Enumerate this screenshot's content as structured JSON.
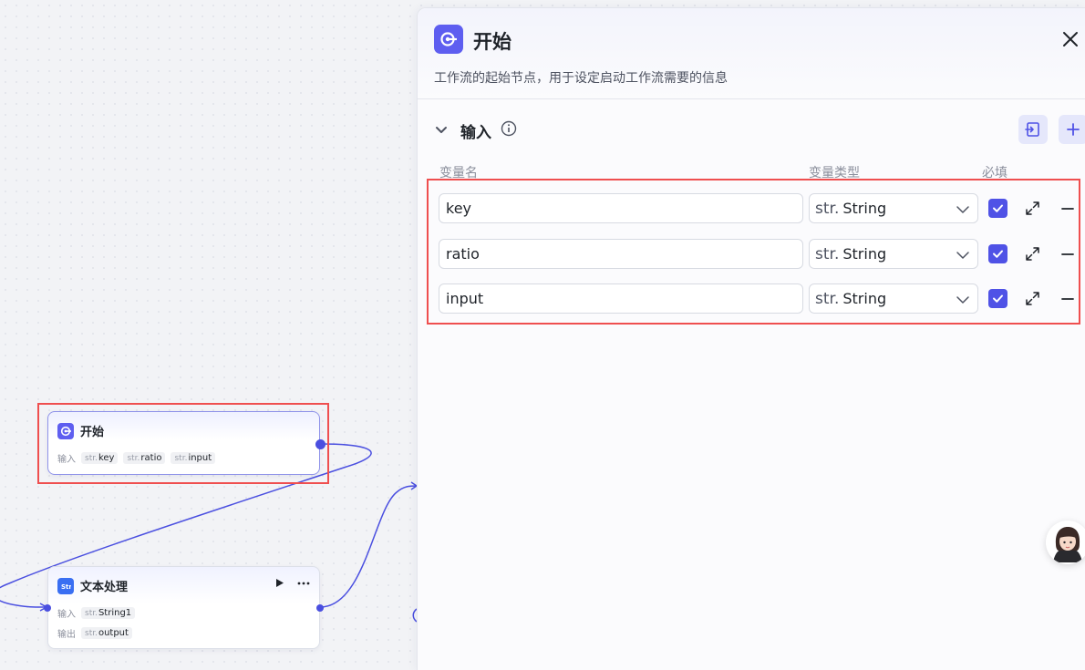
{
  "canvas": {
    "start_node": {
      "title": "开始",
      "input_label": "输入",
      "params": [
        {
          "type": "str.",
          "name": "key"
        },
        {
          "type": "str.",
          "name": "ratio"
        },
        {
          "type": "str.",
          "name": "input"
        }
      ]
    },
    "text_node": {
      "title": "文本处理",
      "run_icon": "play-icon",
      "more_icon": "more-icon",
      "input_label": "输入",
      "output_label": "输出",
      "input_param": {
        "type": "str.",
        "name": "String1"
      },
      "output_param": {
        "type": "str.",
        "name": "output"
      }
    },
    "accent_color": "#4a4fe0",
    "highlight_color": "#ef4f4f"
  },
  "panel": {
    "title": "开始",
    "description": "工作流的起始节点，用于设定启动工作流需要的信息",
    "close_icon": "close-icon",
    "section": {
      "title": "输入",
      "info_icon": "info-icon",
      "import_icon": "import-icon",
      "add_icon": "plus-icon"
    },
    "columns": {
      "name": "变量名",
      "type": "变量类型",
      "required": "必填"
    },
    "variables": [
      {
        "name": "key",
        "type_prefix": "str.",
        "type": "String",
        "required": true
      },
      {
        "name": "ratio",
        "type_prefix": "str.",
        "type": "String",
        "required": true
      },
      {
        "name": "input",
        "type_prefix": "str.",
        "type": "String",
        "required": true
      }
    ]
  }
}
